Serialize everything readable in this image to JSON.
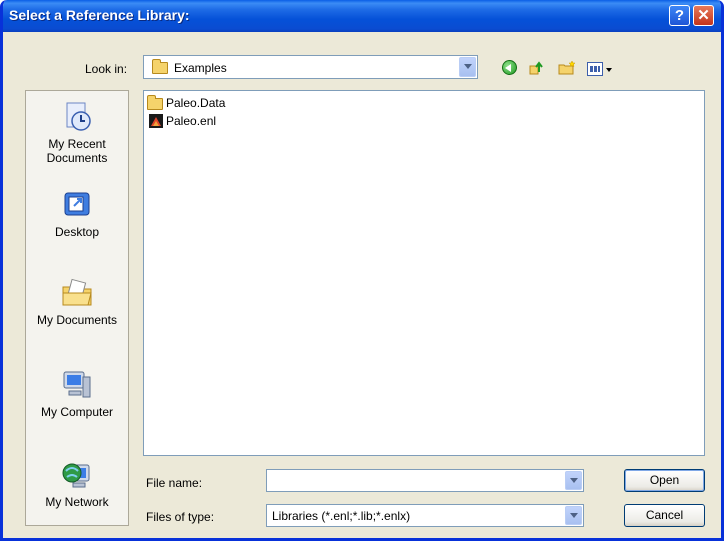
{
  "window": {
    "title": "Select a Reference Library:"
  },
  "titlebar": {
    "help_label": "?",
    "close_label": "✕"
  },
  "lookin": {
    "label": "Look in:",
    "value": "Examples"
  },
  "places": [
    {
      "label_line1": "My Recent",
      "label_line2": "Documents",
      "icon": "recent-documents-icon"
    },
    {
      "label_line1": "Desktop",
      "label_line2": "",
      "icon": "desktop-icon"
    },
    {
      "label_line1": "My Documents",
      "label_line2": "",
      "icon": "my-documents-icon"
    },
    {
      "label_line1": "My Computer",
      "label_line2": "",
      "icon": "my-computer-icon"
    },
    {
      "label_line1": "My Network",
      "label_line2": "",
      "icon": "my-network-icon"
    }
  ],
  "files": [
    {
      "name": "Paleo.Data",
      "icon": "folder-icon"
    },
    {
      "name": "Paleo.enl",
      "icon": "endnote-library-icon"
    }
  ],
  "filename": {
    "label": "File name:",
    "value": ""
  },
  "filetype": {
    "label": "Files of type:",
    "value": "Libraries (*.enl;*.lib;*.enlx)"
  },
  "buttons": {
    "open": "Open",
    "cancel": "Cancel"
  },
  "colors": {
    "title_bar": "#0a5ee6",
    "dialog_bg": "#ece9d8",
    "border": "#0831d9"
  }
}
